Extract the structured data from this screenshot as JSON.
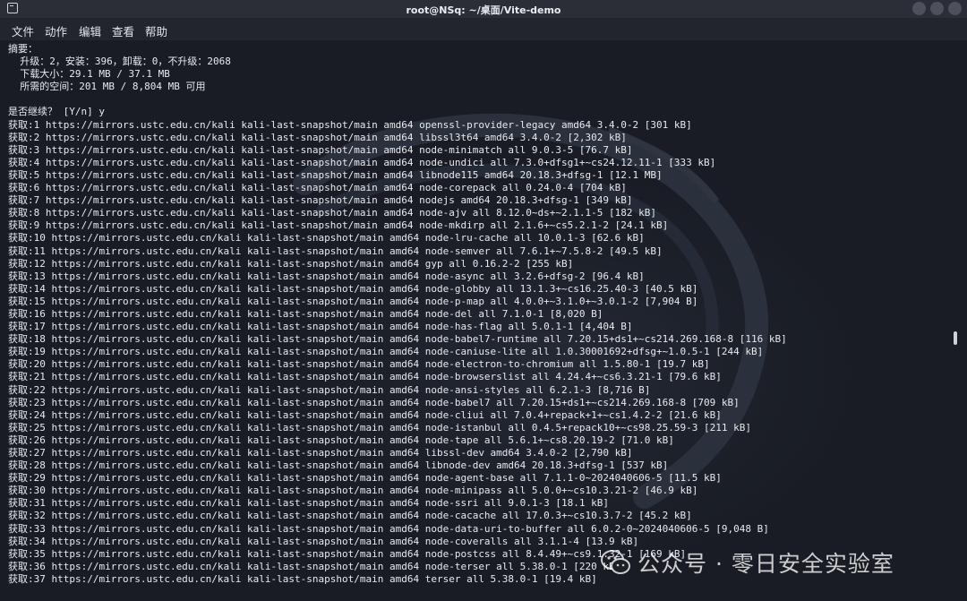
{
  "window": {
    "title": "root@NSq: ~/桌面/Vite-demo"
  },
  "menu": {
    "items": [
      "文件",
      "动作",
      "编辑",
      "查看",
      "帮助"
    ]
  },
  "terminal": {
    "lines": [
      "摘要：",
      "  升级：2，安装：396，卸载：0，不升级：2068",
      "  下载大小：29.1 MB / 37.1 MB",
      "  所需的空间：201 MB / 8,804 MB 可用",
      "",
      "是否继续？ [Y/n] y",
      "获取:1 https://mirrors.ustc.edu.cn/kali kali-last-snapshot/main amd64 openssl-provider-legacy amd64 3.4.0-2 [301 kB]",
      "获取:2 https://mirrors.ustc.edu.cn/kali kali-last-snapshot/main amd64 libssl3t64 amd64 3.4.0-2 [2,302 kB]",
      "获取:3 https://mirrors.ustc.edu.cn/kali kali-last-snapshot/main amd64 node-minimatch all 9.0.3-5 [76.7 kB]",
      "获取:4 https://mirrors.ustc.edu.cn/kali kali-last-snapshot/main amd64 node-undici all 7.3.0+dfsg1+~cs24.12.11-1 [333 kB]",
      "获取:5 https://mirrors.ustc.edu.cn/kali kali-last-snapshot/main amd64 libnode115 amd64 20.18.3+dfsg-1 [12.1 MB]",
      "获取:6 https://mirrors.ustc.edu.cn/kali kali-last-snapshot/main amd64 node-corepack all 0.24.0-4 [704 kB]",
      "获取:7 https://mirrors.ustc.edu.cn/kali kali-last-snapshot/main amd64 nodejs amd64 20.18.3+dfsg-1 [349 kB]",
      "获取:8 https://mirrors.ustc.edu.cn/kali kali-last-snapshot/main amd64 node-ajv all 8.12.0~ds+~2.1.1-5 [182 kB]",
      "获取:9 https://mirrors.ustc.edu.cn/kali kali-last-snapshot/main amd64 node-mkdirp all 2.1.6+~cs5.2.1-2 [24.1 kB]",
      "获取:10 https://mirrors.ustc.edu.cn/kali kali-last-snapshot/main amd64 node-lru-cache all 10.0.1-3 [62.6 kB]",
      "获取:11 https://mirrors.ustc.edu.cn/kali kali-last-snapshot/main amd64 node-semver all 7.6.1+~7.5.8-2 [49.5 kB]",
      "获取:12 https://mirrors.ustc.edu.cn/kali kali-last-snapshot/main amd64 gyp all 0.16.2-2 [255 kB]",
      "获取:13 https://mirrors.ustc.edu.cn/kali kali-last-snapshot/main amd64 node-async all 3.2.6+dfsg-2 [96.4 kB]",
      "获取:14 https://mirrors.ustc.edu.cn/kali kali-last-snapshot/main amd64 node-globby all 13.1.3+~cs16.25.40-3 [40.5 kB]",
      "获取:15 https://mirrors.ustc.edu.cn/kali kali-last-snapshot/main amd64 node-p-map all 4.0.0+~3.1.0+~3.0.1-2 [7,904 B]",
      "获取:16 https://mirrors.ustc.edu.cn/kali kali-last-snapshot/main amd64 node-del all 7.1.0-1 [8,020 B]",
      "获取:17 https://mirrors.ustc.edu.cn/kali kali-last-snapshot/main amd64 node-has-flag all 5.0.1-1 [4,404 B]",
      "获取:18 https://mirrors.ustc.edu.cn/kali kali-last-snapshot/main amd64 node-babel7-runtime all 7.20.15+ds1+~cs214.269.168-8 [116 kB]",
      "获取:19 https://mirrors.ustc.edu.cn/kali kali-last-snapshot/main amd64 node-caniuse-lite all 1.0.30001692+dfsg+~1.0.5-1 [244 kB]",
      "获取:20 https://mirrors.ustc.edu.cn/kali kali-last-snapshot/main amd64 node-electron-to-chromium all 1.5.80-1 [19.7 kB]",
      "获取:21 https://mirrors.ustc.edu.cn/kali kali-last-snapshot/main amd64 node-browserslist all 4.24.4+~cs6.3.21-1 [79.6 kB]",
      "获取:22 https://mirrors.ustc.edu.cn/kali kali-last-snapshot/main amd64 node-ansi-styles all 6.2.1-3 [8,716 B]",
      "获取:23 https://mirrors.ustc.edu.cn/kali kali-last-snapshot/main amd64 node-babel7 all 7.20.15+ds1+~cs214.269.168-8 [709 kB]",
      "获取:24 https://mirrors.ustc.edu.cn/kali kali-last-snapshot/main amd64 node-cliui all 7.0.4+repack+1+~cs1.4.2-2 [21.6 kB]",
      "获取:25 https://mirrors.ustc.edu.cn/kali kali-last-snapshot/main amd64 node-istanbul all 0.4.5+repack10+~cs98.25.59-3 [211 kB]",
      "获取:26 https://mirrors.ustc.edu.cn/kali kali-last-snapshot/main amd64 node-tape all 5.6.1+~cs8.20.19-2 [71.0 kB]",
      "获取:27 https://mirrors.ustc.edu.cn/kali kali-last-snapshot/main amd64 libssl-dev amd64 3.4.0-2 [2,790 kB]",
      "获取:28 https://mirrors.ustc.edu.cn/kali kali-last-snapshot/main amd64 libnode-dev amd64 20.18.3+dfsg-1 [537 kB]",
      "获取:29 https://mirrors.ustc.edu.cn/kali kali-last-snapshot/main amd64 node-agent-base all 7.1.1-0~2024040606-5 [11.5 kB]",
      "获取:30 https://mirrors.ustc.edu.cn/kali kali-last-snapshot/main amd64 node-minipass all 5.0.0+~cs10.3.21-2 [46.9 kB]",
      "获取:31 https://mirrors.ustc.edu.cn/kali kali-last-snapshot/main amd64 node-ssri all 9.0.1-3 [18.1 kB]",
      "获取:32 https://mirrors.ustc.edu.cn/kali kali-last-snapshot/main amd64 node-cacache all 17.0.3+~cs10.3.7-2 [45.2 kB]",
      "获取:33 https://mirrors.ustc.edu.cn/kali kali-last-snapshot/main amd64 node-data-uri-to-buffer all 6.0.2-0~2024040606-5 [9,048 B]",
      "获取:34 https://mirrors.ustc.edu.cn/kali kali-last-snapshot/main amd64 node-coveralls all 3.1.1-4 [13.9 kB]",
      "获取:35 https://mirrors.ustc.edu.cn/kali kali-last-snapshot/main amd64 node-postcss all 8.4.49+~cs9.1.32-1 [169 kB]",
      "获取:36 https://mirrors.ustc.edu.cn/kali kali-last-snapshot/main amd64 node-terser all 5.38.0-1 [220 kB]",
      "获取:37 https://mirrors.ustc.edu.cn/kali kali-last-snapshot/main amd64 terser all 5.38.0-1 [19.4 kB]"
    ]
  },
  "watermark": {
    "text": "公众号 · 零日安全实验室",
    "icon": "wechat-icon"
  }
}
